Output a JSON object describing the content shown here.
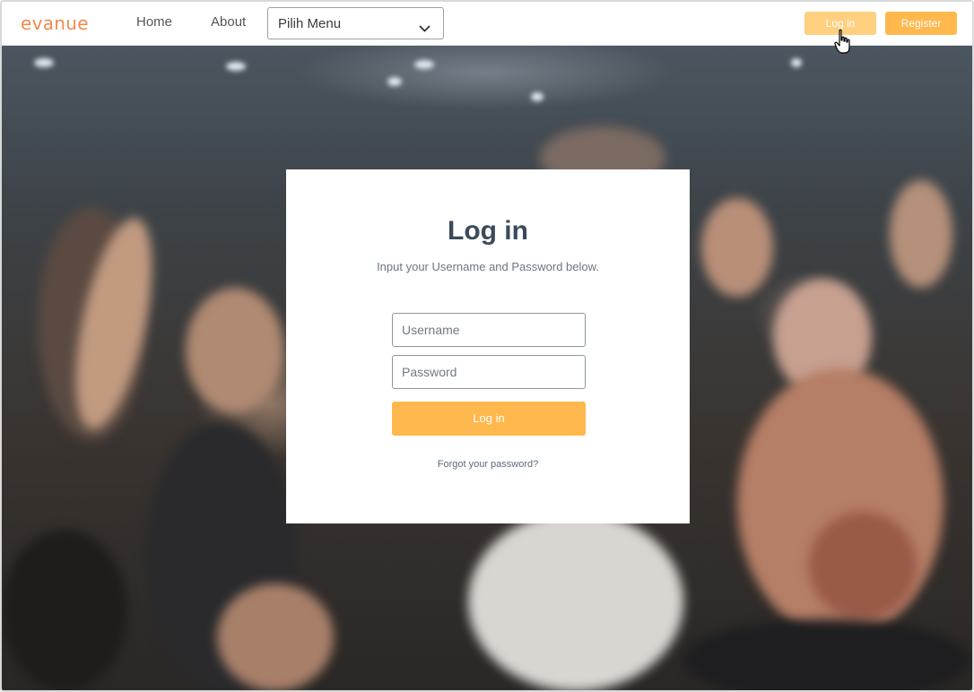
{
  "header": {
    "logo": "evanue",
    "nav": {
      "home": "Home",
      "about": "About"
    },
    "menu_select": {
      "selected": "Pilih Menu"
    },
    "login_button": "Log in",
    "register_button": "Register"
  },
  "login_card": {
    "title": "Log in",
    "subtitle": "Input your Username and Password below.",
    "username_placeholder": "Username",
    "password_placeholder": "Password",
    "submit_label": "Log in",
    "forgot_link": "Forgot your password?"
  },
  "colors": {
    "brand": "#f08a4b",
    "accent": "#ffb84d",
    "accent_light": "#ffd080",
    "title_text": "#3b4a5a"
  },
  "icons": {
    "dropdown": "chevron-down-icon",
    "cursor": "hand-pointer-icon"
  }
}
